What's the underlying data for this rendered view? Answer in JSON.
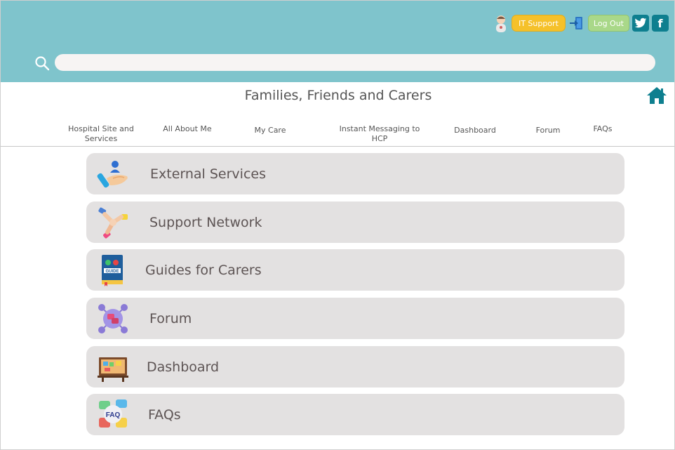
{
  "header": {
    "it_support_label": "IT Support",
    "logout_label": "Log Out",
    "twitter_glyph": "t",
    "facebook_glyph": "f"
  },
  "search": {
    "placeholder": "",
    "value": ""
  },
  "page": {
    "title": "Families, Friends and Carers"
  },
  "nav": {
    "items": [
      {
        "label": "Hospital Site and Services"
      },
      {
        "label": "All About Me"
      },
      {
        "label": "My Care"
      },
      {
        "label": "Instant Messaging to HCP"
      },
      {
        "label": "Dashboard"
      },
      {
        "label": "Forum"
      },
      {
        "label": "FAQs"
      }
    ]
  },
  "cards": [
    {
      "label": "External Services",
      "icon": "helping-hand-person-icon"
    },
    {
      "label": "Support Network",
      "icon": "joined-hands-icon"
    },
    {
      "label": "Guides for Carers",
      "icon": "guide-book-icon"
    },
    {
      "label": "Forum",
      "icon": "forum-network-icon"
    },
    {
      "label": "Dashboard",
      "icon": "dashboard-board-icon"
    },
    {
      "label": "FAQs",
      "icon": "faq-bubbles-icon"
    }
  ],
  "colors": {
    "header_bg": "#7fc4cc",
    "it_support_bg": "#f5c12a",
    "logout_bg": "#a9d889",
    "social_bg": "#0e7f8f",
    "card_bg": "#e3e1e1",
    "home_icon": "#0e7f8f"
  }
}
